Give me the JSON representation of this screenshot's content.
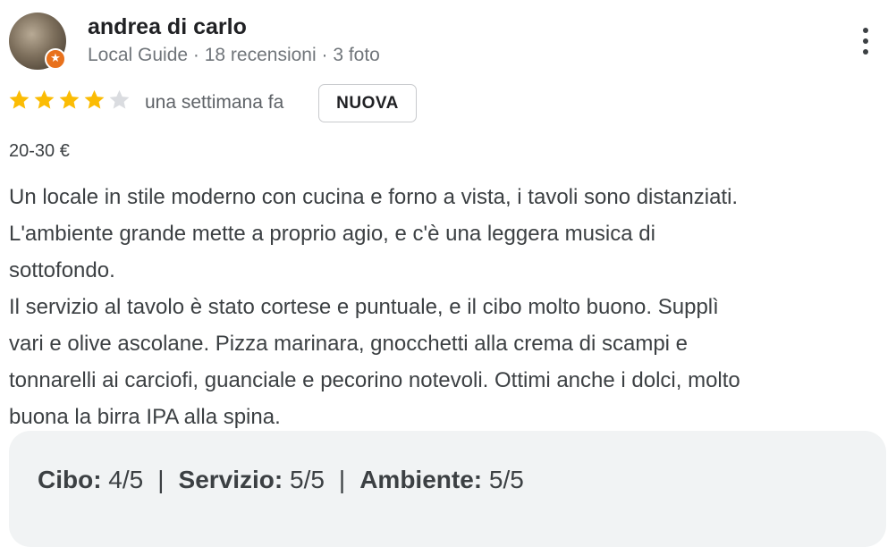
{
  "review": {
    "author": {
      "name": "andrea di carlo",
      "meta": "Local Guide · 18 recensioni · 3 foto",
      "badge_icon": "local-guide-star-icon",
      "badge_color": "#e8711c"
    },
    "menu_icon": "more-vert-icon",
    "rating": {
      "value": 4,
      "max": 5,
      "filled_color": "#fbbc04",
      "empty_color": "#dadce0"
    },
    "time_ago": "una settimana fa",
    "badge_new": "NUOVA",
    "price": "20-30 €",
    "text": "Un locale in stile moderno con cucina e forno a vista, i tavoli sono distanziati.\nL'ambiente grande mette a proprio agio, e c'è una leggera musica di\nsottofondo.\nIl servizio al tavolo è stato cortese e puntuale, e il cibo molto buono. Supplì\nvari e olive ascolane. Pizza marinara, gnocchetti alla crema di scampi e\ntonnarelli ai carciofi, guanciale e pecorino notevoli. Ottimi anche i dolci, molto\nbuona la birra IPA alla spina.",
    "attributes": [
      {
        "label": "Cibo",
        "value": "4/5"
      },
      {
        "label": "Servizio",
        "value": "5/5"
      },
      {
        "label": "Ambiente",
        "value": "5/5"
      }
    ],
    "attributes_separator": "|"
  }
}
